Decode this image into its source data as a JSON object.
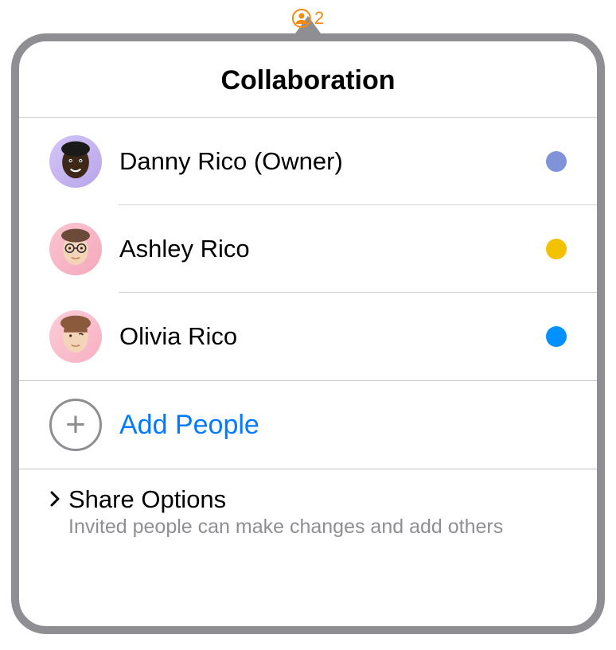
{
  "badge": {
    "count": "2"
  },
  "popover": {
    "title": "Collaboration"
  },
  "people": [
    {
      "name": "Danny Rico (Owner)",
      "presence_color": "#8092d8",
      "avatar_bg": "avatar-bg-purple"
    },
    {
      "name": "Ashley Rico",
      "presence_color": "#f2c200",
      "avatar_bg": "avatar-bg-pink1"
    },
    {
      "name": "Olivia Rico",
      "presence_color": "#0091ff",
      "avatar_bg": "avatar-bg-pink2"
    }
  ],
  "add_people": {
    "label": "Add People"
  },
  "share_options": {
    "title": "Share Options",
    "subtitle": "Invited people can make changes and add others"
  }
}
